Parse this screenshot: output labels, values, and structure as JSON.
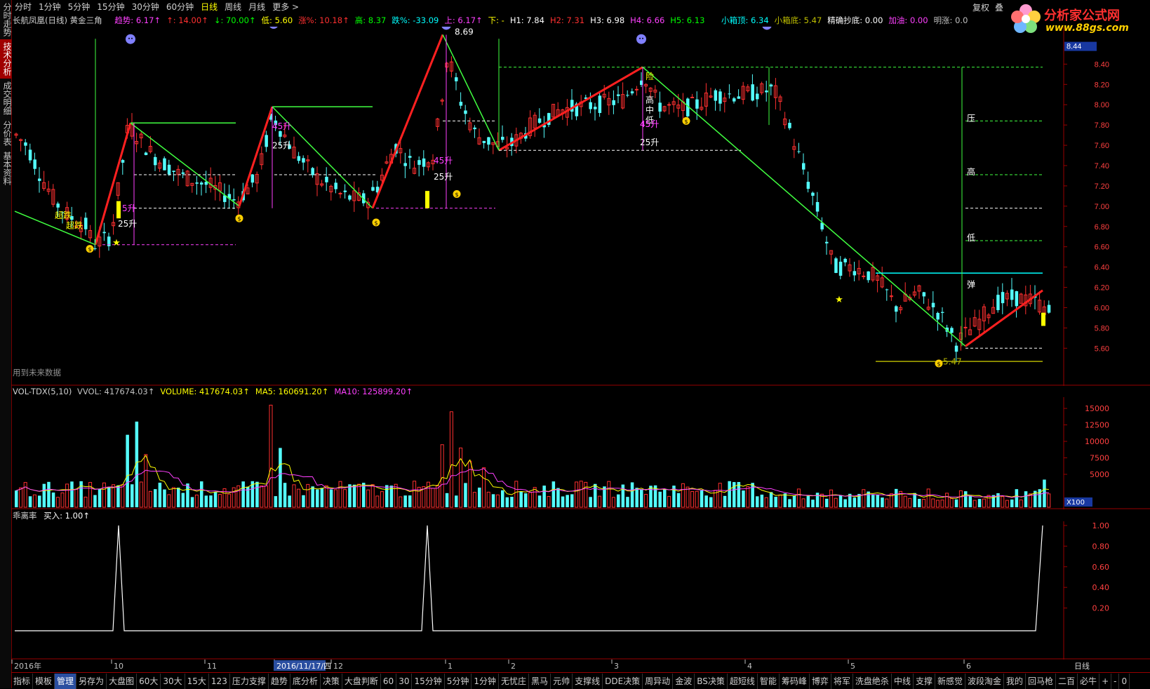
{
  "timeframes": [
    "分时",
    "1分钟",
    "5分钟",
    "15分钟",
    "30分钟",
    "60分钟",
    "日线",
    "周线",
    "月线",
    "更多 >"
  ],
  "active_timeframe_index": 6,
  "right_buttons": [
    "复权",
    "叠"
  ],
  "sidebar_tabs": [
    "分时走势",
    "技术分析",
    "成交明细",
    "分价表",
    "基本资料"
  ],
  "active_sidebar_index": 1,
  "logo": {
    "title": "分析家公式网",
    "url": "www.88gs.com"
  },
  "main_info": {
    "stock": "长航凤凰(日线)",
    "indicator": "黄金三角",
    "items": [
      {
        "text": "趋势: 6.17↑",
        "color": "#ff40ff"
      },
      {
        "text": "↑: 14.00↑",
        "color": "#ff3030"
      },
      {
        "text": "↓: 70.00↑",
        "color": "#00ff00"
      },
      {
        "text": "低: 5.60",
        "color": "#ffff00"
      },
      {
        "text": "涨%: 10.18↑",
        "color": "#ff3030"
      },
      {
        "text": "高: 8.37",
        "color": "#00ff00"
      },
      {
        "text": "跌%: -33.09",
        "color": "#00ffff"
      },
      {
        "text": "上: 6.17↑",
        "color": "#ff40ff"
      },
      {
        "text": "下: -",
        "color": "#ffff00"
      },
      {
        "text": "H1: 7.84",
        "color": "#ffffff"
      },
      {
        "text": "H2: 7.31",
        "color": "#ff3030"
      },
      {
        "text": "H3: 6.98",
        "color": "#ffffff"
      },
      {
        "text": "H4: 6.66",
        "color": "#ff40ff"
      },
      {
        "text": "H5: 6.13",
        "color": "#00ff00"
      }
    ],
    "right_items": [
      {
        "text": "小箱顶: 6.34",
        "color": "#00ffff"
      },
      {
        "text": "小箱底: 5.47",
        "color": "#c0c000"
      },
      {
        "text": "精确抄底: 0.00",
        "color": "#ffffff"
      },
      {
        "text": "加油: 0.00",
        "color": "#ff40ff"
      },
      {
        "text": "明涨: 0.0",
        "color": "#c0c0c0"
      }
    ]
  },
  "future_note": "用到未来数据",
  "price_axis": {
    "ticks": [
      "8.40",
      "8.20",
      "8.00",
      "7.80",
      "7.60",
      "7.40",
      "7.20",
      "7.00",
      "6.80",
      "6.60",
      "6.40",
      "6.20",
      "6.00",
      "5.80",
      "5.60"
    ],
    "min": 5.45,
    "max": 8.7,
    "current": "8.44"
  },
  "chart_labels": {
    "peak_869": "8.69",
    "low_547": "5.47",
    "ya": "压",
    "gao": "高",
    "di": "低",
    "tan": "弹",
    "xian": "险",
    "gao2": "高",
    "zhong": "中",
    "di2": "低",
    "chao_fall": "超跌",
    "chao_fall2": "超跌",
    "s25a": "25升",
    "s25b": "25升",
    "s25c": "25升",
    "s25d": "25升",
    "s45a": "45升",
    "s45b": "45升",
    "s45c": "45升",
    "s45d": "45升",
    "s5": "5升"
  },
  "vol_info": {
    "name": "VOL-TDX(5,10)",
    "items": [
      {
        "text": "VVOL: 417674.03↑",
        "color": "#c0c0c0"
      },
      {
        "text": "VOLUME: 417674.03↑",
        "color": "#ffff00"
      },
      {
        "text": "MA5: 160691.20↑",
        "color": "#ffff00"
      },
      {
        "text": "MA10: 125899.20↑",
        "color": "#ff40ff"
      }
    ],
    "ticks": [
      "15000",
      "12500",
      "10000",
      "7500",
      "5000"
    ],
    "unit": "X100"
  },
  "dev_info": {
    "name": "乖离率",
    "buy": "买入: 1.00↑",
    "ticks": [
      "1.00",
      "0.80",
      "0.60",
      "0.40",
      "0.20"
    ]
  },
  "date_axis": [
    {
      "label": "2016年",
      "color": "#c0c0c0"
    },
    {
      "label": "10",
      "color": "#c0c0c0"
    },
    {
      "label": "11",
      "color": "#c0c0c0"
    },
    {
      "label": "2016/11/17/四",
      "color": "#ffffff",
      "highlight": true
    },
    {
      "label": "12",
      "color": "#c0c0c0"
    },
    {
      "label": "1",
      "color": "#c0c0c0"
    },
    {
      "label": "2",
      "color": "#c0c0c0"
    },
    {
      "label": "3",
      "color": "#c0c0c0"
    },
    {
      "label": "4",
      "color": "#c0c0c0"
    },
    {
      "label": "5",
      "color": "#c0c0c0"
    },
    {
      "label": "6",
      "color": "#c0c0c0"
    }
  ],
  "axis_period": "日线",
  "bottom_tabs": [
    "指标",
    "模板",
    "管理",
    "另存为",
    "大盘图",
    "60大",
    "30大",
    "15大",
    "123",
    "压力支撑",
    "趋势",
    "底分析",
    "决策",
    "大盘判断",
    "60",
    "30",
    "15分钟",
    "5分钟",
    "1分钟",
    "无忧庄",
    "黑马",
    "元帅",
    "支撑线",
    "DDE决策",
    "周异动",
    "金波",
    "BS决策",
    "超短线",
    "智能",
    "筹码峰",
    "博弈",
    "将军",
    "洗盘绝杀",
    "中线",
    "支撑",
    "新感觉",
    "波段淘金",
    "我的",
    "回马枪",
    "二百",
    "必牛"
  ],
  "active_bottom_index": 2,
  "bottom_right": [
    "+",
    "-",
    "0"
  ]
}
